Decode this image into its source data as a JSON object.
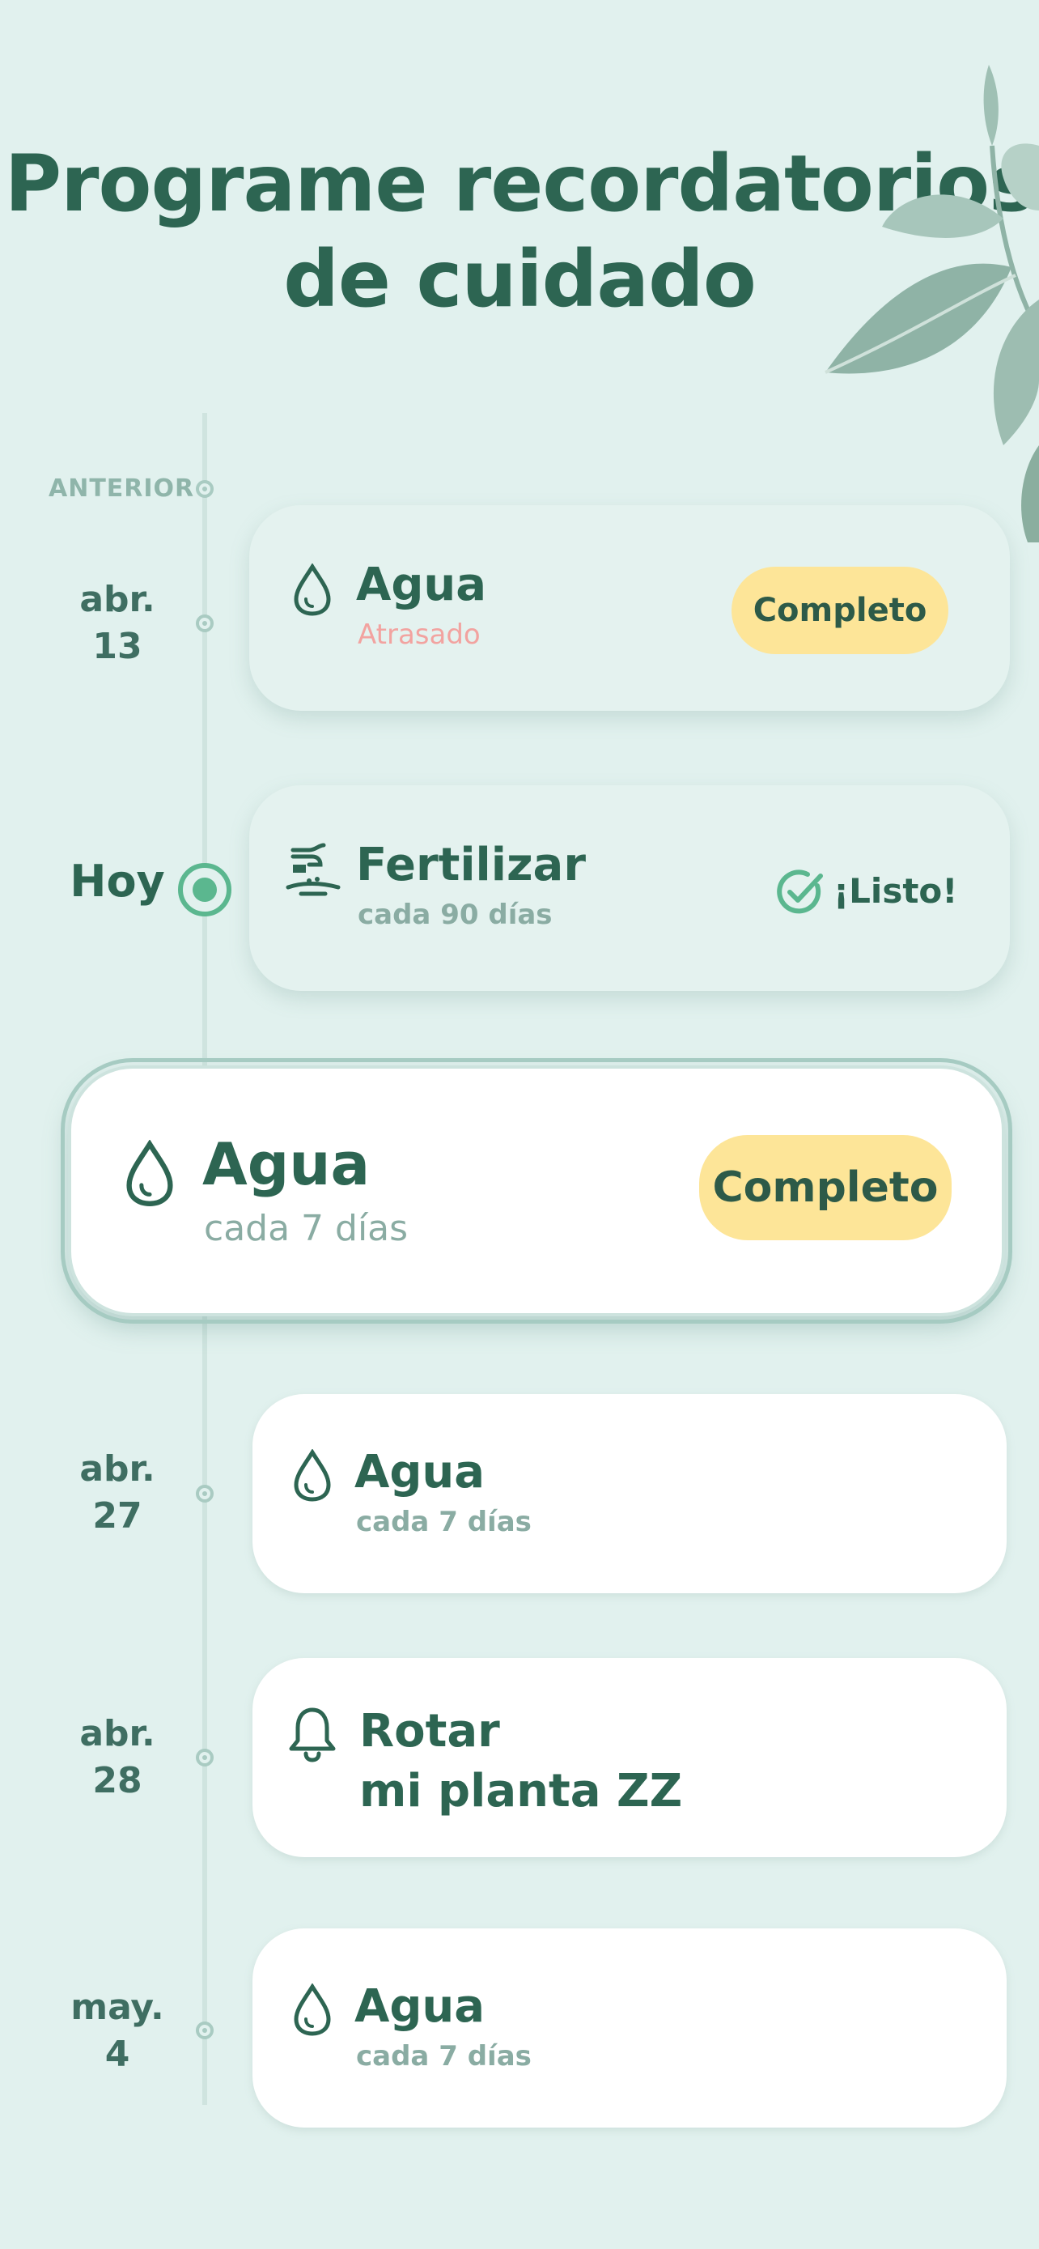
{
  "title": {
    "line1": "Programe recordatorios",
    "line2": "de cuidado"
  },
  "timeline": {
    "previous_label": "ANTERIOR"
  },
  "items": [
    {
      "date_line1": "abr.",
      "date_line2": "13",
      "icon": "water-drop-icon",
      "name": "Agua",
      "subtitle": "Atrasado",
      "action": "Completo"
    },
    {
      "date_line1": "Hoy",
      "icon": "fertilize-icon",
      "name": "Fertilizar",
      "subtitle": "cada 90 días",
      "status": "¡Listo!"
    },
    {
      "icon": "water-drop-icon",
      "name": "Agua",
      "subtitle": "cada 7 días",
      "action": "Completo"
    },
    {
      "date_line1": "abr.",
      "date_line2": "27",
      "icon": "water-drop-icon",
      "name": "Agua",
      "subtitle": "cada 7 días"
    },
    {
      "date_line1": "abr.",
      "date_line2": "28",
      "icon": "bell-icon",
      "name_line1": "Rotar",
      "name_line2": "mi planta ZZ"
    },
    {
      "date_line1": "may.",
      "date_line2": "4",
      "icon": "water-drop-icon",
      "name": "Agua",
      "subtitle": "cada 7 días"
    }
  ],
  "colors": {
    "background": "#e1f1ee",
    "primary_text": "#2d6552",
    "accent_green": "#5bb78f",
    "button_yellow": "#fde598",
    "overdue": "#f2a3a0"
  }
}
